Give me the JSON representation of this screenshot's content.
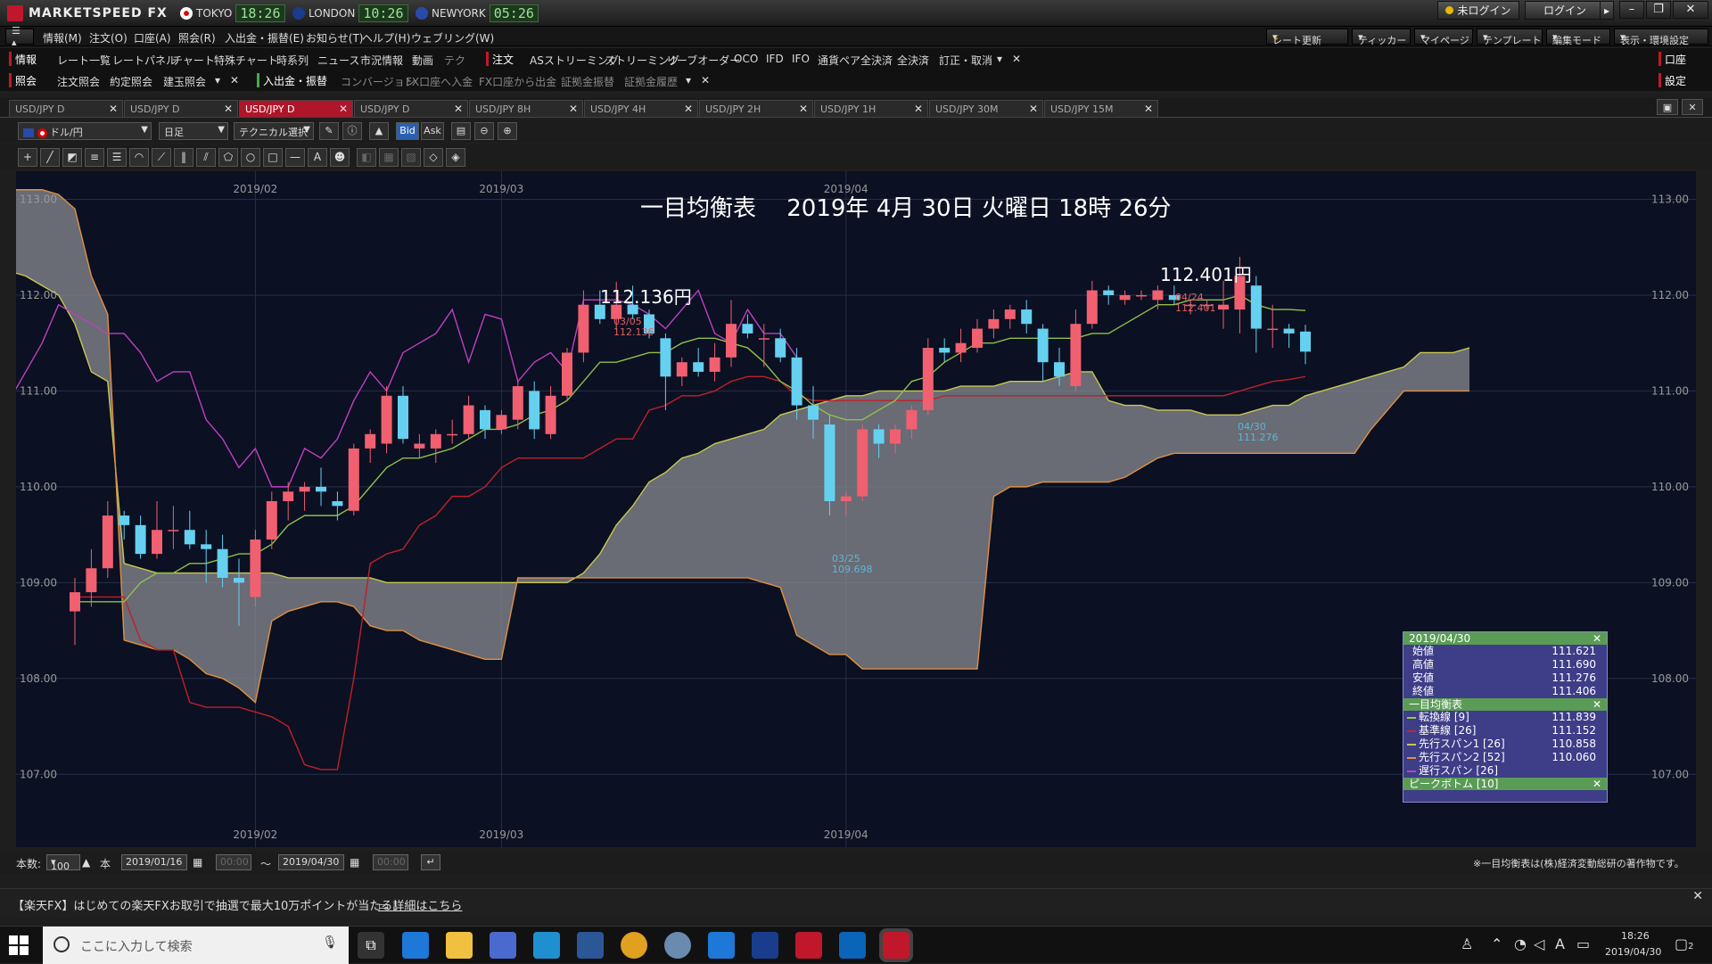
{
  "app": {
    "brand": "MARKETSPEED FX",
    "clocks": [
      {
        "city": "TOKYO",
        "time": "18:26",
        "flag_color": "#d00"
      },
      {
        "city": "LONDON",
        "time": "10:26",
        "flag_color": "#1a3c8c"
      },
      {
        "city": "NEWYORK",
        "time": "05:26",
        "flag_color": "#2a4aa8"
      }
    ],
    "login_status": "未ログイン",
    "login_button": "ログイン"
  },
  "menu": {
    "items": [
      "情報(M)",
      "注文(O)",
      "口座(A)",
      "照会(R)",
      "入出金・振替(E)",
      "お知らせ(T)",
      "ヘルプ(H)",
      "ウェブリング(W)"
    ],
    "right_dropdowns": [
      "レート更新",
      "ティッカー",
      "マイページ",
      "テンプレート",
      "編集モード",
      "表示・環境設定"
    ]
  },
  "nav1": {
    "section": "情報",
    "items": [
      "レート一覧",
      "レートパネル",
      "チャート",
      "特殊チャート",
      "時系列",
      "ニュース",
      "市況情報",
      "動画",
      "テク"
    ],
    "section2": "注文",
    "items2": [
      "ASストリーミング",
      "ストリーミング",
      "リーブオーダー",
      "OCO",
      "IFD",
      "IFO",
      "通貨ペア全決済",
      "全決済",
      "訂正・取消"
    ],
    "right": "口座"
  },
  "nav2": {
    "section": "照会",
    "items": [
      "注文照会",
      "約定照会",
      "建玉照会"
    ],
    "section2": "入出金・振替",
    "items2": [
      "コンバージョン",
      "FX口座へ入金",
      "FX口座から出金",
      "証拠金振替",
      "証拠金履歴"
    ],
    "right": "設定"
  },
  "tabs": [
    {
      "label": "USD/JPY D",
      "active": false
    },
    {
      "label": "USD/JPY D",
      "active": false
    },
    {
      "label": "USD/JPY D",
      "active": true
    },
    {
      "label": "USD/JPY D",
      "active": false
    },
    {
      "label": "USD/JPY 8H",
      "active": false
    },
    {
      "label": "USD/JPY 4H",
      "active": false
    },
    {
      "label": "USD/JPY 2H",
      "active": false
    },
    {
      "label": "USD/JPY 1H",
      "active": false
    },
    {
      "label": "USD/JPY 30M",
      "active": false
    },
    {
      "label": "USD/JPY 15M",
      "active": false
    }
  ],
  "toolbar": {
    "pair": "ドル/円",
    "timeframe": "日足",
    "technical": "テクニカル選択",
    "bid": "Bid",
    "ask": "Ask"
  },
  "bottom": {
    "count_label": "本数:",
    "count_value": "100",
    "count_unit": "本",
    "from_date": "2019/01/16",
    "from_time": "00:00",
    "tilde": "～",
    "to_date": "2019/04/30",
    "to_time": "00:00",
    "copyright": "※一目均衡表は(株)経済変動総研の著作物です。"
  },
  "banner": {
    "text": "【楽天FX】はじめての楽天FXお取引で抽選で最大10万ポイントが当たる！",
    "link": "詳細はこちら"
  },
  "taskbar": {
    "search_placeholder": "ここに入力して検索",
    "time": "18:26",
    "date": "2019/04/30",
    "ime": "A",
    "notif": "2"
  },
  "info_panel": {
    "date": "2019/04/30",
    "ohlc": [
      {
        "label": "始値",
        "value": "111.621"
      },
      {
        "label": "高値",
        "value": "111.690"
      },
      {
        "label": "安値",
        "value": "111.276"
      },
      {
        "label": "終値",
        "value": "111.406"
      }
    ],
    "ichimoku_title": "一目均衡表",
    "ichimoku": [
      {
        "label": "転換線 [9]",
        "value": "111.839",
        "color": "#9acd32"
      },
      {
        "label": "基準線 [26]",
        "value": "111.152",
        "color": "#d0202a"
      },
      {
        "label": "先行スパン1 [26]",
        "value": "110.858",
        "color": "#c8c850"
      },
      {
        "label": "先行スパン2 [52]",
        "value": "110.060",
        "color": "#e09040"
      },
      {
        "label": "遅行スパン [26]",
        "value": "",
        "color": "#c040c0"
      }
    ],
    "peak_title": "ピークボトム [10]"
  },
  "chart_data": {
    "type": "candlestick",
    "title": "一目均衡表　 2019年 4月 30日 火曜日 18時 26分",
    "ylim": [
      106.5,
      113.2
    ],
    "y_ticks": [
      "113.00",
      "112.00",
      "111.00",
      "110.00",
      "109.00",
      "108.00",
      "107.00"
    ],
    "x_ticks": [
      "2019/02",
      "2019/03",
      "2019/04"
    ],
    "high_marker": {
      "big": "112.401円",
      "date": "04/24",
      "value": "112.401"
    },
    "peak_marker": {
      "big": "112.136円",
      "date": "03/05",
      "value": "112.136"
    },
    "low_marker": {
      "date": "03/25",
      "value": "109.698"
    },
    "last_marker": {
      "date": "04/30",
      "value": "111.276"
    },
    "candles": [
      {
        "o": 108.7,
        "h": 109.05,
        "l": 108.35,
        "c": 108.9
      },
      {
        "o": 108.9,
        "h": 109.35,
        "l": 108.75,
        "c": 109.15
      },
      {
        "o": 109.15,
        "h": 109.85,
        "l": 109.05,
        "c": 109.7
      },
      {
        "o": 109.7,
        "h": 109.75,
        "l": 109.45,
        "c": 109.6
      },
      {
        "o": 109.6,
        "h": 109.7,
        "l": 109.25,
        "c": 109.3
      },
      {
        "o": 109.3,
        "h": 109.85,
        "l": 109.25,
        "c": 109.55
      },
      {
        "o": 109.55,
        "h": 109.8,
        "l": 109.35,
        "c": 109.55
      },
      {
        "o": 109.55,
        "h": 109.75,
        "l": 109.35,
        "c": 109.4
      },
      {
        "o": 109.4,
        "h": 109.55,
        "l": 109.0,
        "c": 109.35
      },
      {
        "o": 109.35,
        "h": 109.5,
        "l": 108.95,
        "c": 109.05
      },
      {
        "o": 109.05,
        "h": 109.25,
        "l": 108.55,
        "c": 109.0
      },
      {
        "o": 108.85,
        "h": 109.55,
        "l": 108.75,
        "c": 109.45
      },
      {
        "o": 109.45,
        "h": 109.95,
        "l": 109.35,
        "c": 109.85
      },
      {
        "o": 109.85,
        "h": 110.05,
        "l": 109.65,
        "c": 109.95
      },
      {
        "o": 109.95,
        "h": 110.05,
        "l": 109.75,
        "c": 110.0
      },
      {
        "o": 110.0,
        "h": 110.2,
        "l": 109.8,
        "c": 109.95
      },
      {
        "o": 109.85,
        "h": 109.95,
        "l": 109.65,
        "c": 109.8
      },
      {
        "o": 109.75,
        "h": 110.45,
        "l": 109.7,
        "c": 110.4
      },
      {
        "o": 110.4,
        "h": 110.6,
        "l": 110.25,
        "c": 110.55
      },
      {
        "o": 110.45,
        "h": 111.05,
        "l": 110.35,
        "c": 110.95
      },
      {
        "o": 110.95,
        "h": 111.05,
        "l": 110.45,
        "c": 110.5
      },
      {
        "o": 110.4,
        "h": 110.55,
        "l": 110.3,
        "c": 110.45
      },
      {
        "o": 110.4,
        "h": 110.6,
        "l": 110.25,
        "c": 110.55
      },
      {
        "o": 110.55,
        "h": 110.7,
        "l": 110.45,
        "c": 110.55
      },
      {
        "o": 110.55,
        "h": 110.95,
        "l": 110.5,
        "c": 110.85
      },
      {
        "o": 110.8,
        "h": 110.85,
        "l": 110.5,
        "c": 110.6
      },
      {
        "o": 110.6,
        "h": 110.8,
        "l": 110.55,
        "c": 110.75
      },
      {
        "o": 110.7,
        "h": 111.1,
        "l": 110.6,
        "c": 111.05
      },
      {
        "o": 111.0,
        "h": 111.1,
        "l": 110.5,
        "c": 110.6
      },
      {
        "o": 110.55,
        "h": 111.05,
        "l": 110.5,
        "c": 110.95
      },
      {
        "o": 110.95,
        "h": 111.45,
        "l": 110.9,
        "c": 111.4
      },
      {
        "o": 111.4,
        "h": 112.05,
        "l": 111.3,
        "c": 111.9
      },
      {
        "o": 111.9,
        "h": 112.05,
        "l": 111.7,
        "c": 111.75
      },
      {
        "o": 111.75,
        "h": 112.14,
        "l": 111.65,
        "c": 111.9
      },
      {
        "o": 111.9,
        "h": 112.1,
        "l": 111.75,
        "c": 111.8
      },
      {
        "o": 111.8,
        "h": 111.85,
        "l": 111.55,
        "c": 111.6
      },
      {
        "o": 111.55,
        "h": 111.6,
        "l": 110.8,
        "c": 111.15
      },
      {
        "o": 111.15,
        "h": 111.35,
        "l": 111.05,
        "c": 111.3
      },
      {
        "o": 111.3,
        "h": 111.45,
        "l": 111.15,
        "c": 111.2
      },
      {
        "o": 111.2,
        "h": 111.5,
        "l": 111.1,
        "c": 111.35
      },
      {
        "o": 111.35,
        "h": 111.95,
        "l": 111.25,
        "c": 111.7
      },
      {
        "o": 111.7,
        "h": 111.8,
        "l": 111.55,
        "c": 111.6
      },
      {
        "o": 111.55,
        "h": 111.7,
        "l": 111.25,
        "c": 111.55
      },
      {
        "o": 111.55,
        "h": 111.65,
        "l": 111.3,
        "c": 111.35
      },
      {
        "o": 111.35,
        "h": 111.45,
        "l": 110.7,
        "c": 110.85
      },
      {
        "o": 110.85,
        "h": 111.05,
        "l": 110.5,
        "c": 110.7
      },
      {
        "o": 110.65,
        "h": 110.75,
        "l": 109.7,
        "c": 109.85
      },
      {
        "o": 109.85,
        "h": 109.95,
        "l": 109.7,
        "c": 109.9
      },
      {
        "o": 109.9,
        "h": 110.65,
        "l": 109.85,
        "c": 110.6
      },
      {
        "o": 110.6,
        "h": 110.65,
        "l": 110.3,
        "c": 110.45
      },
      {
        "o": 110.45,
        "h": 110.65,
        "l": 110.35,
        "c": 110.6
      },
      {
        "o": 110.6,
        "h": 110.85,
        "l": 110.5,
        "c": 110.8
      },
      {
        "o": 110.8,
        "h": 111.55,
        "l": 110.75,
        "c": 111.45
      },
      {
        "o": 111.45,
        "h": 111.55,
        "l": 111.3,
        "c": 111.4
      },
      {
        "o": 111.4,
        "h": 111.65,
        "l": 111.3,
        "c": 111.5
      },
      {
        "o": 111.45,
        "h": 111.75,
        "l": 111.4,
        "c": 111.65
      },
      {
        "o": 111.65,
        "h": 111.85,
        "l": 111.55,
        "c": 111.75
      },
      {
        "o": 111.75,
        "h": 111.9,
        "l": 111.65,
        "c": 111.85
      },
      {
        "o": 111.85,
        "h": 111.95,
        "l": 111.6,
        "c": 111.7
      },
      {
        "o": 111.65,
        "h": 111.7,
        "l": 111.1,
        "c": 111.3
      },
      {
        "o": 111.3,
        "h": 111.45,
        "l": 111.05,
        "c": 111.15
      },
      {
        "o": 111.05,
        "h": 111.85,
        "l": 111.0,
        "c": 111.7
      },
      {
        "o": 111.7,
        "h": 112.15,
        "l": 111.65,
        "c": 112.05
      },
      {
        "o": 112.05,
        "h": 112.1,
        "l": 111.9,
        "c": 112.0
      },
      {
        "o": 111.95,
        "h": 112.05,
        "l": 111.9,
        "c": 112.0
      },
      {
        "o": 112.0,
        "h": 112.05,
        "l": 111.95,
        "c": 112.0
      },
      {
        "o": 111.95,
        "h": 112.1,
        "l": 111.85,
        "c": 112.05
      },
      {
        "o": 112.0,
        "h": 112.1,
        "l": 111.9,
        "c": 111.95
      },
      {
        "o": 111.9,
        "h": 111.95,
        "l": 111.8,
        "c": 111.9
      },
      {
        "o": 111.9,
        "h": 111.95,
        "l": 111.85,
        "c": 111.9
      },
      {
        "o": 111.85,
        "h": 112.15,
        "l": 111.65,
        "c": 111.9
      },
      {
        "o": 111.85,
        "h": 112.4,
        "l": 111.6,
        "c": 112.2
      },
      {
        "o": 112.1,
        "h": 112.2,
        "l": 111.4,
        "c": 111.65
      },
      {
        "o": 111.65,
        "h": 111.9,
        "l": 111.45,
        "c": 111.65
      },
      {
        "o": 111.65,
        "h": 111.7,
        "l": 111.45,
        "c": 111.6
      },
      {
        "o": 111.62,
        "h": 111.69,
        "l": 111.28,
        "c": 111.41
      }
    ],
    "tenkan": [
      108.8,
      108.8,
      108.8,
      108.8,
      109.0,
      109.1,
      109.1,
      109.2,
      109.2,
      109.25,
      109.3,
      109.3,
      109.4,
      109.6,
      109.7,
      109.7,
      109.7,
      109.8,
      110.0,
      110.2,
      110.3,
      110.3,
      110.35,
      110.4,
      110.5,
      110.6,
      110.6,
      110.65,
      110.75,
      110.8,
      110.9,
      111.1,
      111.3,
      111.3,
      111.35,
      111.4,
      111.4,
      111.5,
      111.55,
      111.55,
      111.5,
      111.45,
      111.3,
      111.1,
      111.0,
      110.85,
      110.75,
      110.7,
      110.7,
      110.8,
      110.9,
      111.1,
      111.15,
      111.3,
      111.4,
      111.5,
      111.5,
      111.55,
      111.55,
      111.55,
      111.55,
      111.55,
      111.6,
      111.6,
      111.7,
      111.8,
      111.9,
      111.9,
      111.95,
      111.95,
      111.95,
      112.0,
      111.9,
      111.85,
      111.85,
      111.84
    ],
    "kijun": [
      108.85,
      108.85,
      108.85,
      108.85,
      108.4,
      108.3,
      108.3,
      107.75,
      107.7,
      107.7,
      107.7,
      107.65,
      107.6,
      107.5,
      107.1,
      107.05,
      107.05,
      108.0,
      109.2,
      109.3,
      109.35,
      109.6,
      109.7,
      109.9,
      109.9,
      110.0,
      110.2,
      110.3,
      110.3,
      110.3,
      110.3,
      110.3,
      110.4,
      110.5,
      110.5,
      110.8,
      110.85,
      110.95,
      110.95,
      111.0,
      111.1,
      111.15,
      111.15,
      111.1,
      110.95,
      110.9,
      110.9,
      110.9,
      110.9,
      110.9,
      110.9,
      110.9,
      110.9,
      110.95,
      110.95,
      110.95,
      110.95,
      110.95,
      110.95,
      110.95,
      110.95,
      110.95,
      110.95,
      110.95,
      110.95,
      110.95,
      110.95,
      110.95,
      110.95,
      110.95,
      110.95,
      111.0,
      111.05,
      111.1,
      111.12,
      111.15
    ],
    "chikou": [
      110.8,
      110.8,
      110.7,
      110.7,
      110.9,
      110.6,
      110.9,
      111.2,
      111.5,
      111.9,
      111.8,
      111.7,
      111.6,
      111.6,
      111.4,
      111.1,
      111.2,
      111.2,
      110.7,
      110.5,
      110.2,
      110.4,
      110.0,
      110.0,
      110.4,
      110.3,
      110.5,
      110.9,
      111.2,
      111.0,
      111.4,
      111.5,
      111.6,
      111.85,
      111.3,
      111.8,
      111.75,
      111.1,
      111.3,
      111.4,
      111.2,
      111.95,
      111.95,
      111.95,
      111.9,
      111.8,
      111.65,
      111.85,
      112.05,
      111.6,
      111.5,
      111.85,
      111.6,
      111.6,
      111.35
    ],
    "span1": [
      113.1,
      113.1,
      113.05,
      112.9,
      112.6,
      112.3,
      112.25,
      112.2,
      112.1,
      112.0,
      111.7,
      111.2,
      111.1,
      109.2,
      109.15,
      109.1,
      109.1,
      109.1,
      109.1,
      109.1,
      109.1,
      109.1,
      109.1,
      109.05,
      109.05,
      109.05,
      109.05,
      109.05,
      109.05,
      109.0,
      109.0,
      109.0,
      109.0,
      109.0,
      109.0,
      109.0,
      109.0,
      109.0,
      109.0,
      109.0,
      109.0,
      109.1,
      109.3,
      109.6,
      109.8,
      110.05,
      110.15,
      110.3,
      110.35,
      110.45,
      110.5,
      110.55,
      110.6,
      110.75,
      110.8,
      110.85,
      110.9,
      110.95,
      110.95,
      111.0,
      111.0,
      111.0,
      111.0,
      111.0,
      111.05,
      111.05,
      111.05,
      111.1,
      111.1,
      111.1,
      111.15,
      111.2,
      111.2,
      110.9,
      110.85,
      110.85,
      110.8,
      110.8,
      110.8,
      110.75,
      110.75,
      110.75,
      110.8,
      110.85,
      110.85,
      110.95,
      111.0,
      111.05,
      111.1,
      111.15,
      111.2,
      111.25,
      111.4,
      111.4,
      111.4,
      111.45
    ],
    "span2": [
      113.1,
      113.1,
      113.1,
      113.1,
      113.1,
      113.1,
      113.1,
      113.1,
      113.1,
      113.05,
      112.9,
      112.2,
      111.8,
      108.4,
      108.35,
      108.3,
      108.3,
      108.2,
      108.05,
      108.0,
      107.9,
      107.75,
      108.6,
      108.7,
      108.75,
      108.8,
      108.8,
      108.75,
      108.55,
      108.5,
      108.5,
      108.4,
      108.35,
      108.3,
      108.25,
      108.2,
      108.2,
      109.05,
      109.05,
      109.05,
      109.05,
      109.05,
      109.05,
      109.05,
      109.05,
      109.05,
      109.05,
      109.05,
      109.05,
      109.05,
      109.05,
      109.05,
      109.0,
      108.95,
      108.45,
      108.35,
      108.25,
      108.25,
      108.1,
      108.1,
      108.1,
      108.1,
      108.1,
      108.1,
      108.1,
      108.1,
      109.9,
      110.0,
      110.0,
      110.05,
      110.05,
      110.05,
      110.05,
      110.05,
      110.1,
      110.2,
      110.3,
      110.35,
      110.35,
      110.35,
      110.35,
      110.35,
      110.35,
      110.35,
      110.35,
      110.35,
      110.35,
      110.35,
      110.35,
      110.6,
      110.8,
      111.0,
      111.0,
      111.0,
      111.0,
      111.0
    ]
  }
}
